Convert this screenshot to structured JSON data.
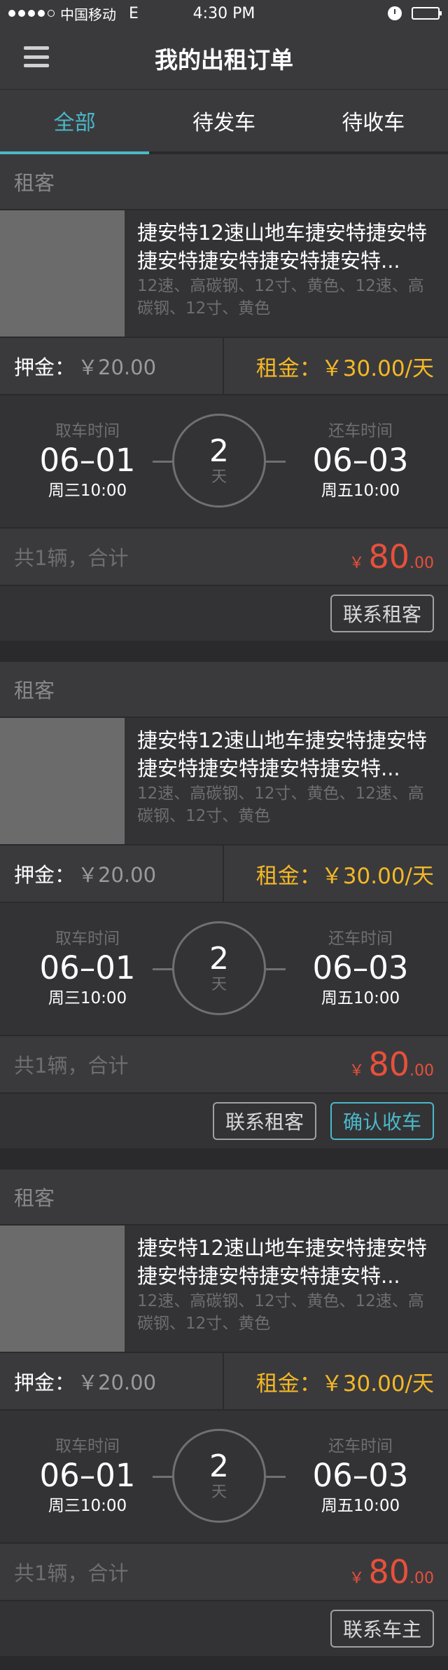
{
  "status_bar": {
    "carrier": "中国移动",
    "network": "E",
    "time": "4:30 PM"
  },
  "header": {
    "title": "我的出租订单"
  },
  "tabs": [
    {
      "label": "全部",
      "active": true
    },
    {
      "label": "待发车",
      "active": false
    },
    {
      "label": "待收车",
      "active": false
    }
  ],
  "orders": [
    {
      "renter_label": "租客",
      "product_title": "捷安特12速山地车捷安特捷安特捷安特捷安特捷安特捷安特...",
      "product_specs": "12速、高碳钢、12寸、黄色、12速、高碳钢、12寸、黄色",
      "deposit_label": "押金：",
      "deposit_value": "￥20.00",
      "rent": "租金：￥30.00/天",
      "pickup_label": "取车时间",
      "pickup_date": "06–01",
      "pickup_week": "周三10:00",
      "return_label": "还车时间",
      "return_date": "06–03",
      "return_week": "周五10:00",
      "duration_num": "2",
      "duration_unit": "天",
      "total_label": "共1辆，合计",
      "currency": "￥",
      "amount_int": "80",
      "amount_dec": ".00",
      "buttons": [
        {
          "label": "联系租客",
          "style": "gray"
        }
      ]
    },
    {
      "renter_label": "租客",
      "product_title": "捷安特12速山地车捷安特捷安特捷安特捷安特捷安特捷安特...",
      "product_specs": "12速、高碳钢、12寸、黄色、12速、高碳钢、12寸、黄色",
      "deposit_label": "押金：",
      "deposit_value": "￥20.00",
      "rent": "租金：￥30.00/天",
      "pickup_label": "取车时间",
      "pickup_date": "06–01",
      "pickup_week": "周三10:00",
      "return_label": "还车时间",
      "return_date": "06–03",
      "return_week": "周五10:00",
      "duration_num": "2",
      "duration_unit": "天",
      "total_label": "共1辆，合计",
      "currency": "￥",
      "amount_int": "80",
      "amount_dec": ".00",
      "buttons": [
        {
          "label": "联系租客",
          "style": "gray"
        },
        {
          "label": "确认收车",
          "style": "teal"
        }
      ]
    },
    {
      "renter_label": "租客",
      "product_title": "捷安特12速山地车捷安特捷安特捷安特捷安特捷安特捷安特...",
      "product_specs": "12速、高碳钢、12寸、黄色、12速、高碳钢、12寸、黄色",
      "deposit_label": "押金：",
      "deposit_value": "￥20.00",
      "rent": "租金：￥30.00/天",
      "pickup_label": "取车时间",
      "pickup_date": "06–01",
      "pickup_week": "周三10:00",
      "return_label": "还车时间",
      "return_date": "06–03",
      "return_week": "周五10:00",
      "duration_num": "2",
      "duration_unit": "天",
      "total_label": "共1辆，合计",
      "currency": "￥",
      "amount_int": "80",
      "amount_dec": ".00",
      "buttons": [
        {
          "label": "联系车主",
          "style": "gray"
        }
      ]
    }
  ],
  "colors": {
    "accent": "#4ab8c8",
    "rent": "#f5b825",
    "total": "#e8503a",
    "background": "#2a2a2d"
  },
  "icons": {
    "menu": "hamburger-menu-icon",
    "alarm": "alarm-clock-icon",
    "battery": "battery-icon"
  }
}
